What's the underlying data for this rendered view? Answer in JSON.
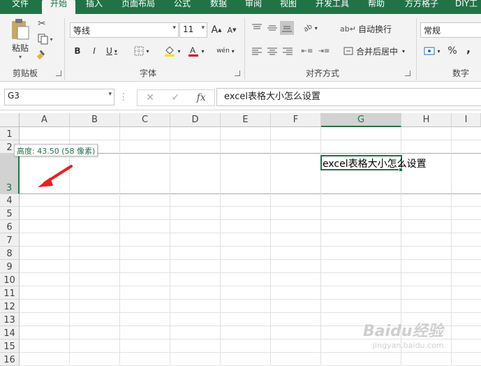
{
  "tabs": [
    "文件",
    "开始",
    "插入",
    "页面布局",
    "公式",
    "数据",
    "审阅",
    "视图",
    "开发工具",
    "帮助",
    "方方格子",
    "DIY工"
  ],
  "active_tab": "开始",
  "clipboard": {
    "paste_label": "粘贴",
    "group_label": "剪贴板"
  },
  "font": {
    "name": "等线",
    "size": "11",
    "group_label": "字体",
    "bold": "B",
    "italic": "I",
    "underline": "U",
    "grow": "A",
    "shrink": "A",
    "phonetic": "wén"
  },
  "alignment": {
    "wrap_label": "自动换行",
    "merge_label": "合并后居中",
    "group_label": "对齐方式"
  },
  "number": {
    "format": "常规",
    "group_label": "数字",
    "percent": "%",
    "comma": ","
  },
  "formula_bar": {
    "name_box": "G3",
    "fx": "fx",
    "content": "excel表格大小怎么设置",
    "cancel": "✕",
    "enter": "✓"
  },
  "grid": {
    "columns": [
      "A",
      "B",
      "C",
      "D",
      "E",
      "F",
      "G",
      "H",
      "I"
    ],
    "rows": [
      "1",
      "2",
      "3",
      "4",
      "5",
      "6",
      "7",
      "8",
      "9",
      "10",
      "11",
      "12",
      "13",
      "14",
      "15",
      "16"
    ],
    "selected_column": "G",
    "selected_row": "3",
    "cell_g3": "excel表格大小怎么设置",
    "row_height_tooltip": "高度: 43.50 (58 像素)"
  },
  "watermark": {
    "brand": "Baidu经验",
    "url": "jingyan.baidu.com"
  },
  "colors": {
    "excel_green": "#217346",
    "arrow_red": "#e82020",
    "highlight_yellow": "#ffe000",
    "font_red": "#e00000"
  }
}
